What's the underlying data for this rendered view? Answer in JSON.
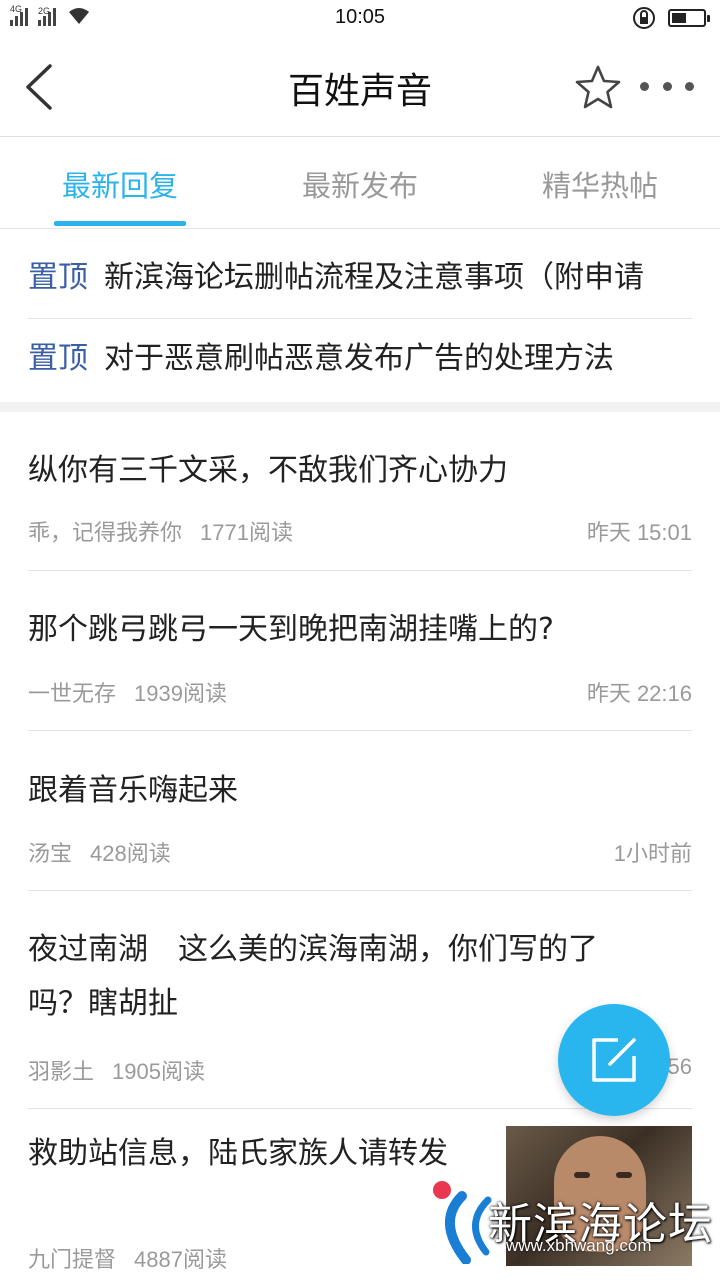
{
  "status_bar": {
    "time": "10:05",
    "network_1": "4G",
    "network_2": "2G"
  },
  "header": {
    "title": "百姓声音"
  },
  "tabs": [
    {
      "label": "最新回复",
      "active": true
    },
    {
      "label": "最新发布",
      "active": false
    },
    {
      "label": "精华热帖",
      "active": false
    }
  ],
  "pinned": [
    {
      "tag": "置顶",
      "title": "新滨海论坛删帖流程及注意事项（附申请"
    },
    {
      "tag": "置顶",
      "title": "对于恶意刷帖恶意发布广告的处理方法"
    }
  ],
  "posts": [
    {
      "title": "纵你有三千文采，不敌我们齐心协力",
      "author": "乖，记得我养你",
      "reads": "1771阅读",
      "time": "昨天 15:01"
    },
    {
      "title": "那个跳弓跳弓一天到晚把南湖挂嘴上的?",
      "author": "一世无存",
      "reads": "1939阅读",
      "time": "昨天 22:16"
    },
    {
      "title": "跟着音乐嗨起来",
      "author": "汤宝",
      "reads": "428阅读",
      "time": "1小时前"
    },
    {
      "title": "夜过南湖　这么美的滨海南湖，你们写的了吗？瞎胡扯",
      "author": "羽影土",
      "reads": "1905阅读",
      "time": "56"
    },
    {
      "title": "救助站信息，陆氏家族人请转发",
      "author": "九门提督",
      "reads": "4887阅读",
      "time": ""
    }
  ],
  "watermark": {
    "name": "新滨海论坛",
    "url": "www.xbhwang.com"
  },
  "colors": {
    "accent": "#2cb3ec",
    "pin_tag": "#3b5fa7",
    "meta": "#9a9a9a"
  }
}
